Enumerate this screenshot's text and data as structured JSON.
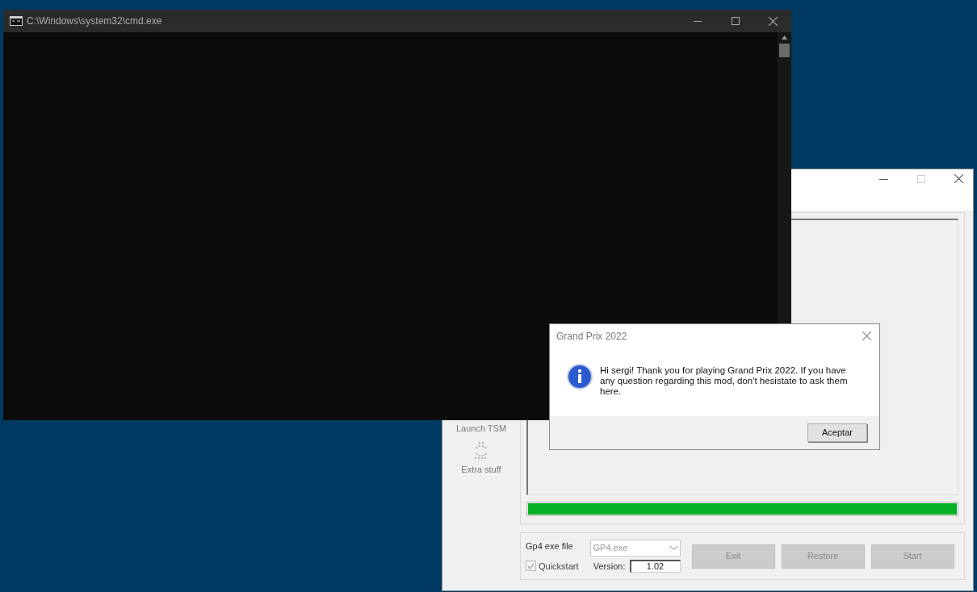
{
  "cmd_window": {
    "title": "C:\\Windows\\system32\\cmd.exe"
  },
  "launcher_window": {
    "sidebar_items": [
      {
        "label": "Launch TSM",
        "kind": "hidden_icon"
      },
      {
        "label": "Extra stuff",
        "kind": "icon"
      }
    ],
    "progress": {
      "level": 1
    },
    "exe_label": "Gp4 exe file",
    "exe_select": {
      "value": "GP4.exe",
      "disabled": true
    },
    "quickstart": {
      "label": "Quickstart",
      "checked": true,
      "disabled": true
    },
    "version_label": "Version:",
    "version": {
      "value": "1.02"
    },
    "buttons": [
      {
        "label": "Exit",
        "disabled": true
      },
      {
        "label": "Restore",
        "disabled": true
      },
      {
        "label": "Start",
        "disabled": true
      }
    ]
  },
  "dialog": {
    "title": "Grand Prix 2022",
    "message": "Hi sergi! Thank you for playing Grand Prix 2022. If you have any question regarding this mod, don't hesistate to ask them here.",
    "button": "Aceptar"
  }
}
